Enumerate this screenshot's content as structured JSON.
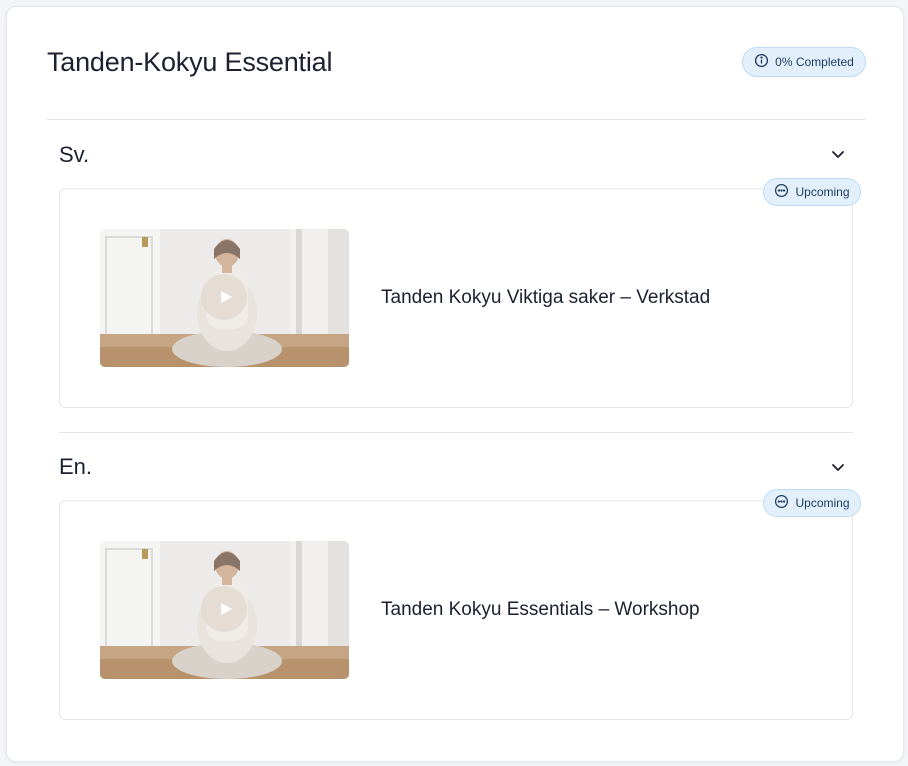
{
  "course": {
    "title": "Tanden-Kokyu Essential",
    "progress_label": "0% Completed",
    "progress_percent": 0
  },
  "sections": [
    {
      "title": "Sv.",
      "lessons": [
        {
          "title": "Tanden Kokyu Viktiga saker – Verkstad",
          "status": "Upcoming"
        }
      ]
    },
    {
      "title": "En.",
      "lessons": [
        {
          "title": "Tanden Kokyu Essentials – Workshop",
          "status": "Upcoming"
        }
      ]
    }
  ],
  "icons": {
    "progress": "info-circle-icon",
    "status": "ellipsis-circle-icon",
    "toggle": "chevron-down-icon",
    "play": "play-icon"
  },
  "colors": {
    "badge_bg": "#e3f0fb",
    "badge_border": "#bcdcf3",
    "badge_text": "#1c3a5c",
    "title_text": "#1b2130"
  }
}
